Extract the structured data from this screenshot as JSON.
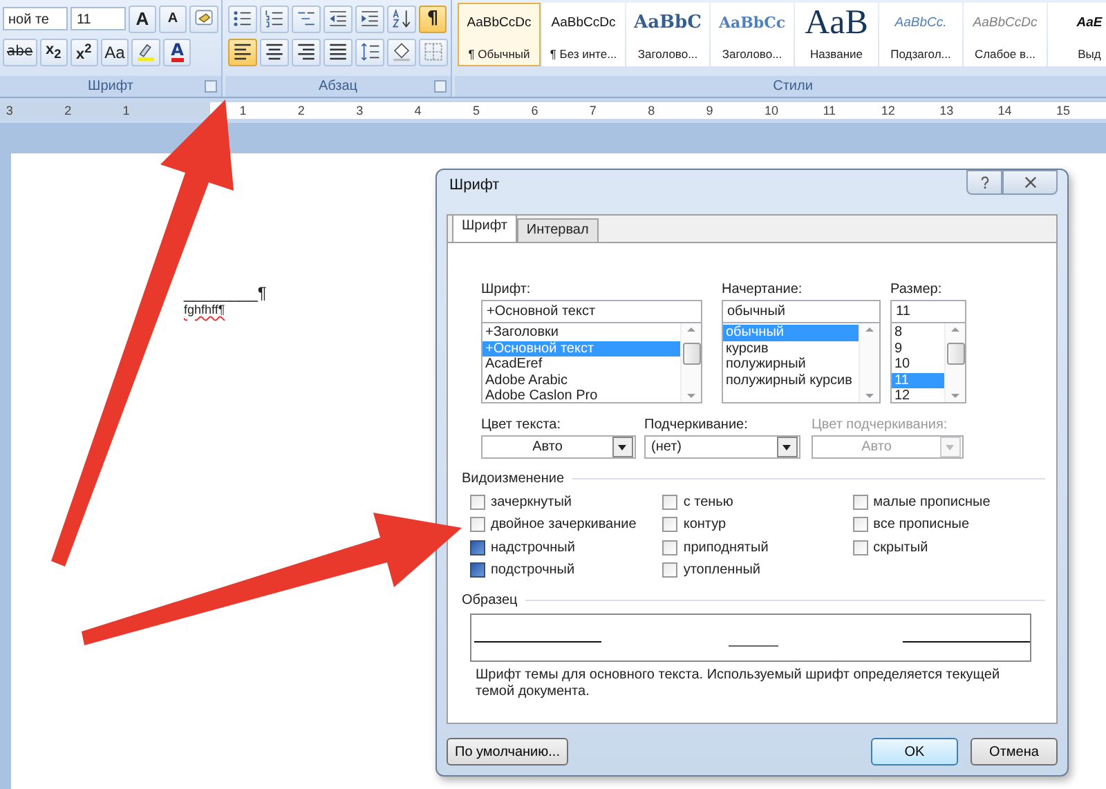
{
  "ribbon": {
    "font_group": {
      "label": "Шрифт",
      "font_name": "ной те",
      "font_size": "11",
      "row1": [
        {
          "kind": "grow",
          "label": "A"
        },
        {
          "kind": "shrink",
          "label": "A"
        },
        {
          "kind": "clear"
        }
      ],
      "row2": [
        {
          "kind": "strike",
          "label": "abe"
        },
        {
          "kind": "sub",
          "label": "x$_{2}$"
        },
        {
          "kind": "sup",
          "label": "x$^{2}$"
        },
        {
          "kind": "case",
          "label": "Aa"
        },
        {
          "kind": "highlight"
        },
        {
          "kind": "fontcolor",
          "label": "A"
        }
      ]
    },
    "paragraph_group": {
      "label": "Абзац",
      "row1": [
        {
          "kind": "bullets",
          "selected": false
        },
        {
          "kind": "numbering",
          "selected": false
        },
        {
          "kind": "multilevel",
          "selected": false
        },
        {
          "kind": "outdent",
          "selected": false
        },
        {
          "kind": "indent",
          "selected": false
        },
        {
          "kind": "sort",
          "selected": false
        },
        {
          "kind": "marks",
          "label": "¶",
          "selected": true
        }
      ],
      "row2": [
        {
          "kind": "left",
          "selected": true
        },
        {
          "kind": "center",
          "selected": false
        },
        {
          "kind": "right",
          "selected": false
        },
        {
          "kind": "justify",
          "selected": false
        },
        {
          "kind": "spacing",
          "selected": false
        },
        {
          "kind": "shading",
          "selected": false
        },
        {
          "kind": "borders",
          "selected": false
        }
      ]
    },
    "styles_group": {
      "label": "Стили",
      "styles": [
        {
          "sample": "AaBbCcDc",
          "name": "¶ Обычный",
          "kind": "normal",
          "selected": true
        },
        {
          "sample": "AaBbCcDc",
          "name": "¶ Без инте...",
          "kind": "normal",
          "selected": false
        },
        {
          "sample": "AaBbC",
          "name": "Заголово...",
          "kind": "heading1",
          "selected": false
        },
        {
          "sample": "AaBbCc",
          "name": "Заголово...",
          "kind": "heading2",
          "selected": false
        },
        {
          "sample": "AaB",
          "name": "Название",
          "kind": "title",
          "selected": false
        },
        {
          "sample": "AaBbCc.",
          "name": "Подзагол...",
          "kind": "subtitle",
          "selected": false
        },
        {
          "sample": "AaBbCcDc",
          "name": "Слабое в...",
          "kind": "subtle",
          "selected": false
        },
        {
          "sample": "AaE",
          "name": "Выд",
          "kind": "emphasis",
          "selected": false
        }
      ]
    }
  },
  "ruler": {
    "marks": [
      "3",
      "2",
      "1",
      "1",
      "2",
      "3",
      "4",
      "5",
      "6",
      "7",
      "8",
      "9",
      "10",
      "11",
      "12",
      "13",
      "14",
      "15"
    ]
  },
  "document": {
    "lines": [
      {
        "text": "________¶",
        "spelling_error": false
      },
      {
        "text": "fghfhff¶",
        "spelling_error": true
      }
    ]
  },
  "dialog": {
    "title": "Шрифт",
    "tabs": [
      {
        "label": "Шрифт",
        "selected": true
      },
      {
        "label": "Интервал",
        "selected": false
      }
    ],
    "font": {
      "label": "Шрифт:",
      "value": "+Основной текст",
      "items": [
        {
          "text": "+Заголовки",
          "selected": false
        },
        {
          "text": "+Основной текст",
          "selected": true
        },
        {
          "text": "AcadEref",
          "selected": false
        },
        {
          "text": "Adobe Arabic",
          "selected": false
        },
        {
          "text": "Adobe Caslon Pro",
          "selected": false
        }
      ]
    },
    "style": {
      "label": "Начертание:",
      "value": "обычный",
      "items": [
        {
          "text": "обычный",
          "selected": true
        },
        {
          "text": "курсив",
          "selected": false
        },
        {
          "text": "полужирный",
          "selected": false
        },
        {
          "text": "полужирный курсив",
          "selected": false
        }
      ]
    },
    "size": {
      "label": "Размер:",
      "value": "11",
      "items": [
        {
          "text": "8",
          "selected": false
        },
        {
          "text": "9",
          "selected": false
        },
        {
          "text": "10",
          "selected": false
        },
        {
          "text": "11",
          "selected": true
        },
        {
          "text": "12",
          "selected": false
        }
      ]
    },
    "dropdowns": [
      {
        "label": "Цвет текста:",
        "value": "Авто",
        "disabled": false
      },
      {
        "label": "Подчеркивание:",
        "value": "(нет)",
        "disabled": false
      },
      {
        "label": "Цвет подчеркивания:",
        "value": "Авто",
        "disabled": true
      }
    ],
    "effects_label": "Видоизменение",
    "effects": [
      [
        {
          "label": "зачеркнутый",
          "checked": false
        },
        {
          "label": "двойное зачеркивание",
          "checked": false
        },
        {
          "label": "надстрочный",
          "checked": true
        },
        {
          "label": "подстрочный",
          "checked": true
        }
      ],
      [
        {
          "label": "с тенью",
          "checked": false
        },
        {
          "label": "контур",
          "checked": false
        },
        {
          "label": "приподнятый",
          "checked": false
        },
        {
          "label": "утопленный",
          "checked": false
        }
      ],
      [
        {
          "label": "малые прописные",
          "checked": false
        },
        {
          "label": "все прописные",
          "checked": false
        },
        {
          "label": "скрытый",
          "checked": false
        }
      ]
    ],
    "preview_label": "Образец",
    "description": "Шрифт темы для основного текста. Используемый шрифт определяется текущей темой документа.",
    "buttons": [
      {
        "label": "По умолчанию...",
        "default": false
      },
      {
        "label": "OK",
        "default": true
      },
      {
        "label": "Отмена",
        "default": false
      }
    ]
  }
}
